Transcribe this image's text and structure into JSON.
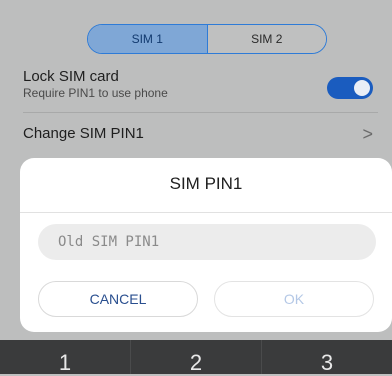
{
  "sim_tabs": [
    {
      "label": "SIM 1",
      "active": true
    },
    {
      "label": "SIM 2",
      "active": false
    }
  ],
  "lock_sim": {
    "title": "Lock SIM card",
    "subtitle": "Require PIN1 to use phone",
    "enabled": true
  },
  "change_pin": {
    "label": "Change SIM PIN1",
    "chevron": ">"
  },
  "dialog": {
    "title": "SIM PIN1",
    "input_placeholder": "Old SIM PIN1",
    "input_value": "",
    "cancel_label": "CANCEL",
    "ok_label": "OK"
  },
  "keypad": {
    "keys": [
      "1",
      "2",
      "3"
    ]
  },
  "colors": {
    "accent": "#1a5cbf",
    "segment_active": "#7fa7d6",
    "ok_disabled_text": "#b4c8e6"
  }
}
